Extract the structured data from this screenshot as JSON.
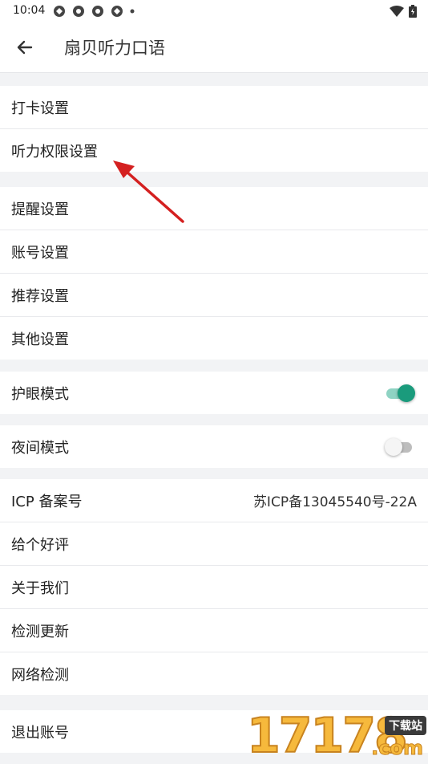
{
  "status_bar": {
    "time": "10:04"
  },
  "app_bar": {
    "title": "扇贝听力口语"
  },
  "groups": [
    {
      "items": [
        {
          "label": "打卡设置"
        },
        {
          "label": "听力权限设置"
        }
      ]
    },
    {
      "items": [
        {
          "label": "提醒设置"
        },
        {
          "label": "账号设置"
        },
        {
          "label": "推荐设置"
        },
        {
          "label": "其他设置"
        }
      ]
    },
    {
      "items": [
        {
          "label": "护眼模式",
          "toggle": "on"
        }
      ]
    },
    {
      "items": [
        {
          "label": "夜间模式",
          "toggle": "off"
        }
      ]
    },
    {
      "items": [
        {
          "label": "ICP 备案号",
          "value": "苏ICP备13045540号-22A"
        },
        {
          "label": "给个好评"
        },
        {
          "label": "关于我们"
        },
        {
          "label": "检测更新"
        },
        {
          "label": "网络检测"
        }
      ]
    },
    {
      "items": [
        {
          "label": "退出账号"
        }
      ]
    }
  ],
  "watermark": {
    "digits": "17178",
    "badge": "下载站",
    "suffix": ".com"
  },
  "colors": {
    "accent": "#1a9b7c",
    "annotation_arrow": "#d42020"
  },
  "icons": [
    "back-arrow-icon",
    "wifi-icon",
    "battery-icon"
  ]
}
